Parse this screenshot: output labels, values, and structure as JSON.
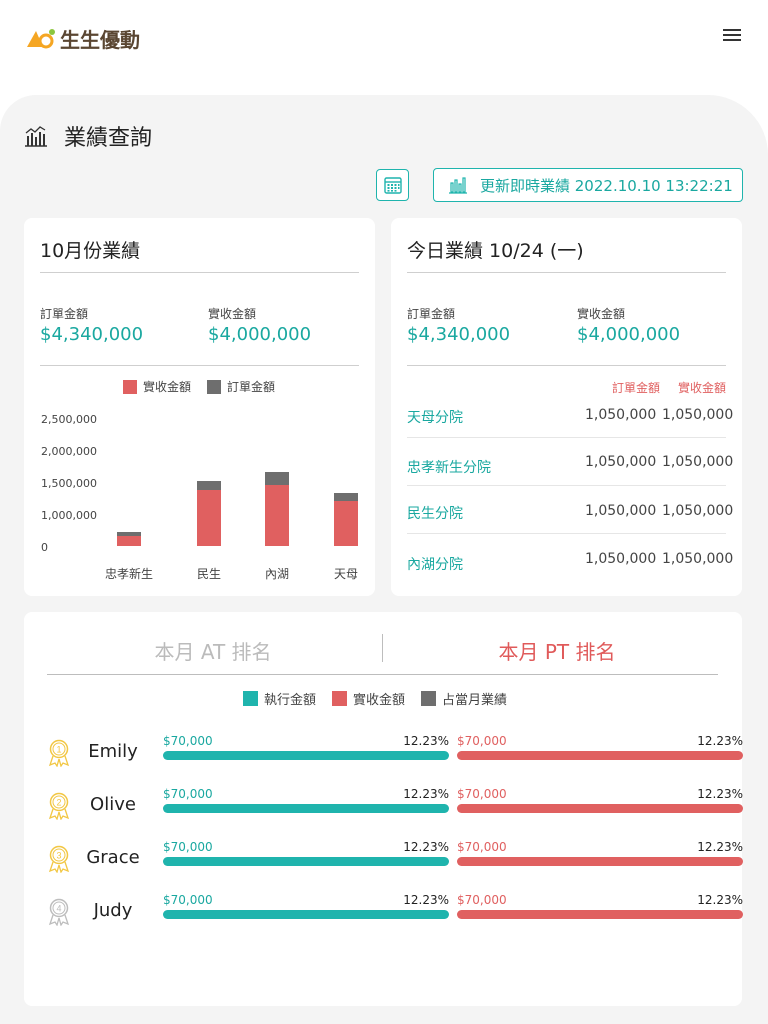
{
  "header": {
    "brand": "生生優動",
    "brand_colors": {
      "orange": "#f5a623",
      "green": "#8cc63f",
      "text": "#5a4632"
    }
  },
  "page": {
    "title": "業績查詢",
    "update_button": "更新即時業績 2022.10.10 13:22:21"
  },
  "month_card": {
    "title": "10月份業績",
    "order_label": "訂單金額",
    "order_value": "$4,340,000",
    "received_label": "實收金額",
    "received_value": "$4,000,000",
    "legend": [
      "實收金額",
      "訂單金額"
    ]
  },
  "chart_data": {
    "type": "bar",
    "stacked": true,
    "categories": [
      "忠孝新生",
      "民生",
      "內湖",
      "天母"
    ],
    "series": [
      {
        "name": "實收金額",
        "color": "#e06060",
        "values": [
          180000,
          1050000,
          1150000,
          850000
        ]
      },
      {
        "name": "訂單金額",
        "color": "#6e6e6e",
        "values": [
          80000,
          180000,
          250000,
          150000
        ]
      }
    ],
    "yticks": [
      "2,500,000",
      "2,000,000",
      "1,500,000",
      "1,000,000",
      "0"
    ],
    "ylim": [
      0,
      2500000
    ]
  },
  "today_card": {
    "title": "今日業績 10/24 (一)",
    "order_label": "訂單金額",
    "order_value": "$4,340,000",
    "received_label": "實收金額",
    "received_value": "$4,000,000",
    "col_order": "訂單金額",
    "col_received": "實收金額",
    "branches": [
      {
        "name": "天母分院",
        "order": "1,050,000",
        "received": "1,050,000"
      },
      {
        "name": "忠孝新生分院",
        "order": "1,050,000",
        "received": "1,050,000"
      },
      {
        "name": "民生分院",
        "order": "1,050,000",
        "received": "1,050,000"
      },
      {
        "name": "內湖分院",
        "order": "1,050,000",
        "received": "1,050,000"
      }
    ]
  },
  "ranking": {
    "tab_at": "本月 AT 排名",
    "tab_pt": "本月 PT 排名",
    "legend": [
      {
        "label": "執行金額",
        "color": "#1fb4ad"
      },
      {
        "label": "實收金額",
        "color": "#e06060"
      },
      {
        "label": "占當月業績",
        "color": "#6e6e6e"
      }
    ],
    "rows": [
      {
        "rank": "1",
        "name": "Emily",
        "exec_amount": "$70,000",
        "exec_pct": "12.23%",
        "recv_amount": "$70,000",
        "recv_pct": "12.23%",
        "medal": "#f2c744"
      },
      {
        "rank": "2",
        "name": "Olive",
        "exec_amount": "$70,000",
        "exec_pct": "12.23%",
        "recv_amount": "$70,000",
        "recv_pct": "12.23%",
        "medal": "#f2c744"
      },
      {
        "rank": "3",
        "name": "Grace",
        "exec_amount": "$70,000",
        "exec_pct": "12.23%",
        "recv_amount": "$70,000",
        "recv_pct": "12.23%",
        "medal": "#f2c744"
      },
      {
        "rank": "4",
        "name": "Judy",
        "exec_amount": "$70,000",
        "exec_pct": "12.23%",
        "recv_amount": "$70,000",
        "recv_pct": "12.23%",
        "medal": "#bdbdbd"
      }
    ]
  }
}
